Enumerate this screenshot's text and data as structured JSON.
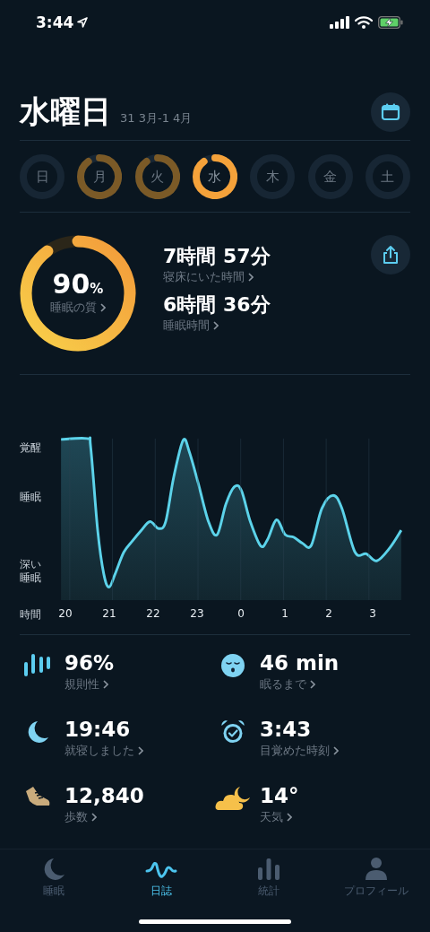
{
  "status_bar": {
    "time": "3:44"
  },
  "header": {
    "title": "水曜日",
    "date_range": "31 3月-1 4月"
  },
  "days": [
    {
      "label": "日",
      "recorded": false,
      "selected": false
    },
    {
      "label": "月",
      "recorded": true,
      "selected": false
    },
    {
      "label": "火",
      "recorded": true,
      "selected": false
    },
    {
      "label": "水",
      "recorded": true,
      "selected": true
    },
    {
      "label": "木",
      "recorded": false,
      "selected": false
    },
    {
      "label": "金",
      "recorded": false,
      "selected": false
    },
    {
      "label": "土",
      "recorded": false,
      "selected": false
    }
  ],
  "summary": {
    "quality": {
      "value": "90",
      "unit": "%",
      "label": "睡眠の質"
    },
    "durations": [
      {
        "value": "7時間 57分",
        "label": "寝床にいた時間"
      },
      {
        "value": "6時間 36分",
        "label": "睡眠時間"
      }
    ]
  },
  "sleep_graph": {
    "y_labels": [
      "覚醒",
      "睡眠",
      "深い睡眠"
    ],
    "x_title": "時間",
    "x_labels": [
      "20",
      "21",
      "22",
      "23",
      "0",
      "1",
      "2",
      "3"
    ]
  },
  "stats": [
    {
      "kind": "regularity",
      "value": "96%",
      "label": "規則性"
    },
    {
      "kind": "fall_asleep",
      "value": "46 min",
      "label": "眠るまで"
    },
    {
      "kind": "bedtime",
      "value": "19:46",
      "label": "就寝しました"
    },
    {
      "kind": "wake",
      "value": "3:43",
      "label": "目覚めた時刻"
    },
    {
      "kind": "steps",
      "value": "12,840",
      "label": "歩数"
    },
    {
      "kind": "weather",
      "value": "14°",
      "label": "天気"
    }
  ],
  "tab_bar": [
    {
      "kind": "sleep",
      "label": "睡眠",
      "selected": false
    },
    {
      "kind": "journal",
      "label": "日誌",
      "selected": true
    },
    {
      "kind": "stats",
      "label": "統計",
      "selected": false
    },
    {
      "kind": "profile",
      "label": "プロフィール",
      "selected": false
    }
  ]
}
